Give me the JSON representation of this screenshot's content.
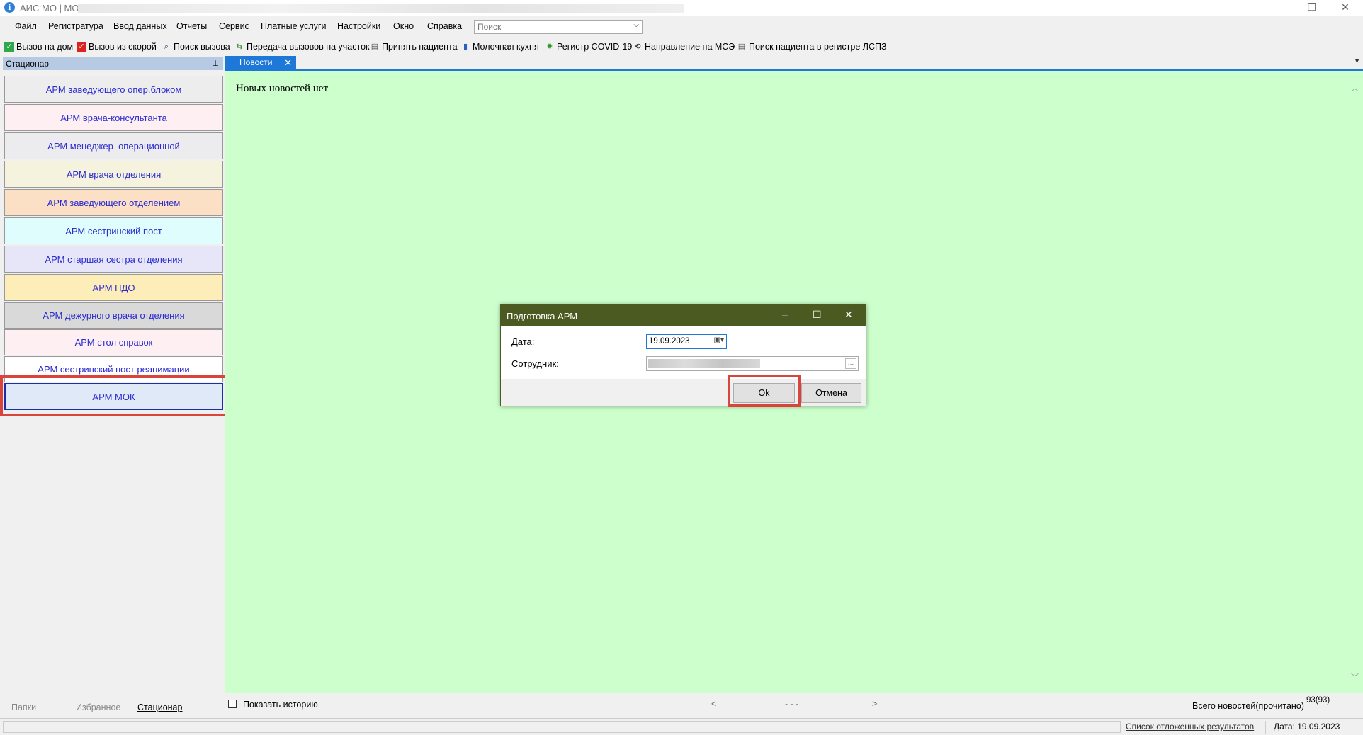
{
  "window": {
    "title": "АИС МО | МО:"
  },
  "menu": [
    "Файл",
    "Регистратура",
    "Ввод данных",
    "Отчеты",
    "Сервис",
    "Платные услуги",
    "Настройки",
    "Окно",
    "Справка"
  ],
  "search": {
    "placeholder": "Поиск"
  },
  "toolbar": [
    {
      "label": "Вызов на дом",
      "icon": "home-call-icon"
    },
    {
      "label": "Вызов из скорой",
      "icon": "ambulance-call-icon"
    },
    {
      "label": "Поиск вызова",
      "icon": "search-call-icon"
    },
    {
      "label": "Передача вызовов на участок",
      "icon": "transfer-icon"
    },
    {
      "label": "Принять пациента",
      "icon": "accept-patient-icon"
    },
    {
      "label": "Молочная кухня",
      "icon": "milk-kitchen-icon"
    },
    {
      "label": "Регистр COVID-19",
      "icon": "covid-icon"
    },
    {
      "label": "Направление на МСЭ",
      "icon": "mse-icon"
    },
    {
      "label": "Поиск пациента в регистре ЛСПЗ",
      "icon": "registry-search-icon"
    }
  ],
  "left_panel": {
    "title": "Стационар",
    "items": [
      {
        "label": "АРМ заведующего опер.блоком",
        "color": "#ededee"
      },
      {
        "label": "АРМ врача-консультанта",
        "color": "#fdeff2"
      },
      {
        "label": "АРМ менеджер  операционной",
        "color": "#ececee"
      },
      {
        "label": "АРМ врача отделения",
        "color": "#f5f3dd"
      },
      {
        "label": "АРМ заведующего отделением",
        "color": "#fbe0c6"
      },
      {
        "label": "АРМ сестринский пост",
        "color": "#e0fdfd"
      },
      {
        "label": "АРМ старшая сестра отделения",
        "color": "#e6e6f8"
      },
      {
        "label": "АРМ ПДО",
        "color": "#fdedb9"
      },
      {
        "label": "АРМ дежурного врача отделения",
        "color": "#d9d9d9"
      },
      {
        "label": "АРМ стол справок",
        "color": "#fdeff2"
      },
      {
        "label": "АРМ сестринский пост реанимации",
        "color": "#ffffff"
      },
      {
        "label": "АРМ МОК",
        "color": "#dfe9f7"
      }
    ],
    "tabs": [
      "Папки",
      "Избранное",
      "Стационар"
    ]
  },
  "content": {
    "tab_label": "Новости",
    "no_news": "Новых новостей нет",
    "show_history": "Показать историю",
    "nav_prev": "<",
    "nav_mid": "- - -",
    "nav_next": ">",
    "total_label": "Всего новостей(прочитано)",
    "total_value": "93(93)"
  },
  "status": {
    "deferred_link": "Список отложенных результатов",
    "date": "Дата: 19.09.2023"
  },
  "dialog": {
    "title": "Подготовка АРМ",
    "date_label": "Дата:",
    "date_value": "19.09.2023",
    "employee_label": "Сотрудник:",
    "ok": "Ok",
    "cancel": "Отмена"
  },
  "colors": {
    "accent": "#1e78d8",
    "dialog_title": "#4b5a20",
    "news_bg": "#ccffcc",
    "highlight": "#d9453b"
  }
}
